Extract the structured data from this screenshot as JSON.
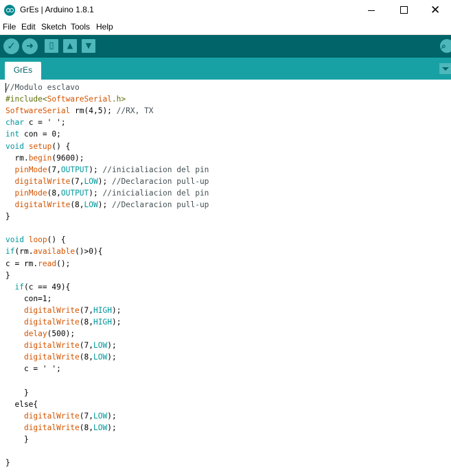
{
  "window": {
    "title": "GrEs | Arduino 1.8.1",
    "minimize_glyph": "",
    "close_glyph": "✕"
  },
  "menu": [
    "File",
    "Edit",
    "Sketch",
    "Tools",
    "Help"
  ],
  "toolbar": {
    "verify_glyph": "✓",
    "upload_glyph": "➜",
    "new_glyph": "▯",
    "open_glyph": "▲",
    "save_glyph": "▼",
    "serial_glyph": "⌕"
  },
  "tabs": [
    {
      "label": "GrEs",
      "active": true
    }
  ],
  "colors": {
    "toolbar": "#006468",
    "tabbar": "#17a1a5",
    "button": "#4db7bb",
    "keyword": "#00979c",
    "function": "#d35400",
    "comment": "#434f54",
    "preprocessor": "#5e6d03"
  },
  "code": [
    [
      {
        "t": "//Modulo esclavo",
        "c": "cm"
      }
    ],
    [
      {
        "t": "#include<",
        "c": "pp"
      },
      {
        "t": "SoftwareSerial",
        "c": "ty"
      },
      {
        "t": ".h>",
        "c": "pp"
      }
    ],
    [
      {
        "t": "SoftwareSerial",
        "c": "ty"
      },
      {
        "t": " rm(4,5); ",
        "c": ""
      },
      {
        "t": "//RX, TX",
        "c": "cm"
      }
    ],
    [
      {
        "t": "char",
        "c": "kw"
      },
      {
        "t": " c = ' ';",
        "c": ""
      }
    ],
    [
      {
        "t": "int",
        "c": "kw"
      },
      {
        "t": " con = 0;",
        "c": ""
      }
    ],
    [
      {
        "t": "void",
        "c": "kw"
      },
      {
        "t": " ",
        "c": ""
      },
      {
        "t": "setup",
        "c": "fn"
      },
      {
        "t": "() {",
        "c": ""
      }
    ],
    [
      {
        "t": "  rm.",
        "c": ""
      },
      {
        "t": "begin",
        "c": "fn"
      },
      {
        "t": "(9600);",
        "c": ""
      }
    ],
    [
      {
        "t": "  ",
        "c": ""
      },
      {
        "t": "pinMode",
        "c": "fn"
      },
      {
        "t": "(7,",
        "c": ""
      },
      {
        "t": "OUTPUT",
        "c": "kw"
      },
      {
        "t": "); ",
        "c": ""
      },
      {
        "t": "//inicialiacion del pin",
        "c": "cm"
      }
    ],
    [
      {
        "t": "  ",
        "c": ""
      },
      {
        "t": "digitalWrite",
        "c": "fn"
      },
      {
        "t": "(7,",
        "c": ""
      },
      {
        "t": "LOW",
        "c": "kw"
      },
      {
        "t": "); ",
        "c": ""
      },
      {
        "t": "//Declaracion pull-up",
        "c": "cm"
      }
    ],
    [
      {
        "t": "  ",
        "c": ""
      },
      {
        "t": "pinMode",
        "c": "fn"
      },
      {
        "t": "(8,",
        "c": ""
      },
      {
        "t": "OUTPUT",
        "c": "kw"
      },
      {
        "t": "); ",
        "c": ""
      },
      {
        "t": "//inicialiacion del pin",
        "c": "cm"
      }
    ],
    [
      {
        "t": "  ",
        "c": ""
      },
      {
        "t": "digitalWrite",
        "c": "fn"
      },
      {
        "t": "(8,",
        "c": ""
      },
      {
        "t": "LOW",
        "c": "kw"
      },
      {
        "t": "); ",
        "c": ""
      },
      {
        "t": "//Declaracion pull-up",
        "c": "cm"
      }
    ],
    [
      {
        "t": "}",
        "c": ""
      }
    ],
    [],
    [
      {
        "t": "void",
        "c": "kw"
      },
      {
        "t": " ",
        "c": ""
      },
      {
        "t": "loop",
        "c": "fn"
      },
      {
        "t": "() {",
        "c": ""
      }
    ],
    [
      {
        "t": "if",
        "c": "kw"
      },
      {
        "t": "(rm.",
        "c": ""
      },
      {
        "t": "available",
        "c": "fn"
      },
      {
        "t": "()>0){",
        "c": ""
      }
    ],
    [
      {
        "t": "c = rm.",
        "c": ""
      },
      {
        "t": "read",
        "c": "fn"
      },
      {
        "t": "();",
        "c": ""
      }
    ],
    [
      {
        "t": "}",
        "c": ""
      }
    ],
    [
      {
        "t": "  ",
        "c": ""
      },
      {
        "t": "if",
        "c": "kw"
      },
      {
        "t": "(c == 49){",
        "c": ""
      }
    ],
    [
      {
        "t": "    con=1;",
        "c": ""
      }
    ],
    [
      {
        "t": "    ",
        "c": ""
      },
      {
        "t": "digitalWrite",
        "c": "fn"
      },
      {
        "t": "(7,",
        "c": ""
      },
      {
        "t": "HIGH",
        "c": "kw"
      },
      {
        "t": ");",
        "c": ""
      }
    ],
    [
      {
        "t": "    ",
        "c": ""
      },
      {
        "t": "digitalWrite",
        "c": "fn"
      },
      {
        "t": "(8,",
        "c": ""
      },
      {
        "t": "HIGH",
        "c": "kw"
      },
      {
        "t": ");",
        "c": ""
      }
    ],
    [
      {
        "t": "    ",
        "c": ""
      },
      {
        "t": "delay",
        "c": "fn"
      },
      {
        "t": "(500);",
        "c": ""
      }
    ],
    [
      {
        "t": "    ",
        "c": ""
      },
      {
        "t": "digitalWrite",
        "c": "fn"
      },
      {
        "t": "(7,",
        "c": ""
      },
      {
        "t": "LOW",
        "c": "kw"
      },
      {
        "t": ");",
        "c": ""
      }
    ],
    [
      {
        "t": "    ",
        "c": ""
      },
      {
        "t": "digitalWrite",
        "c": "fn"
      },
      {
        "t": "(8,",
        "c": ""
      },
      {
        "t": "LOW",
        "c": "kw"
      },
      {
        "t": ");",
        "c": ""
      }
    ],
    [
      {
        "t": "    c = ' ';",
        "c": ""
      }
    ],
    [],
    [
      {
        "t": "    }",
        "c": ""
      }
    ],
    [
      {
        "t": "  else{",
        "c": ""
      }
    ],
    [
      {
        "t": "    ",
        "c": ""
      },
      {
        "t": "digitalWrite",
        "c": "fn"
      },
      {
        "t": "(7,",
        "c": ""
      },
      {
        "t": "LOW",
        "c": "kw"
      },
      {
        "t": ");",
        "c": ""
      }
    ],
    [
      {
        "t": "    ",
        "c": ""
      },
      {
        "t": "digitalWrite",
        "c": "fn"
      },
      {
        "t": "(8,",
        "c": ""
      },
      {
        "t": "LOW",
        "c": "kw"
      },
      {
        "t": ");",
        "c": ""
      }
    ],
    [
      {
        "t": "    }",
        "c": ""
      }
    ],
    [],
    [
      {
        "t": "}",
        "c": ""
      }
    ]
  ]
}
